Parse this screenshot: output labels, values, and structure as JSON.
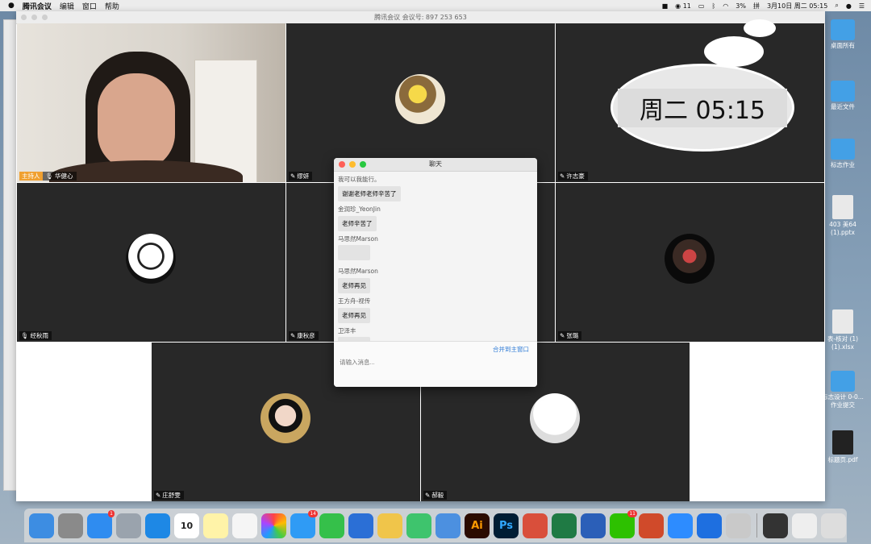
{
  "menubar": {
    "app": "腾讯会议",
    "items": [
      "编辑",
      "窗口",
      "帮助"
    ],
    "wechat_badge": "11",
    "battery": "3%",
    "datetime": "3月10日 周二  05:15"
  },
  "window": {
    "title": "腾讯会议 会议号: 897 253 653"
  },
  "participants": [
    {
      "name": "华健心",
      "host_label": "主持人"
    },
    {
      "name": "缪妍"
    },
    {
      "name": "许志豪"
    },
    {
      "name": "经秋雨"
    },
    {
      "name": "康秋彦"
    },
    {
      "name": "张璐"
    },
    {
      "name": "庄舒雯"
    },
    {
      "name": "郝毅"
    }
  ],
  "overlay_clock": {
    "text": "周二  05:15"
  },
  "chat": {
    "title": "聊天",
    "messages": [
      {
        "sender": "我可以我能行。",
        "text": "谢谢老师老师辛苦了"
      },
      {
        "sender": "金润珍_YeonJin",
        "text": "老师辛苦了"
      },
      {
        "sender": "马思然Marson",
        "text": ""
      },
      {
        "sender": "马思然Marson",
        "text": "老师再见"
      },
      {
        "sender": "王方舟-视传",
        "text": "老师再见"
      },
      {
        "sender": "卫泽丰",
        "text": ""
      }
    ],
    "merge_label": "合并到主窗口",
    "input_placeholder": "请输入消息..."
  },
  "desktop": [
    {
      "label": "桌面所有",
      "kind": "folder"
    },
    {
      "label": "最近文件",
      "kind": "folder"
    },
    {
      "label": "标志作业",
      "kind": "folder"
    },
    {
      "label": "403 美64 (1).pptx",
      "kind": "doc"
    },
    {
      "label": "表-核对 (1)(1).xlsx",
      "kind": "doc"
    },
    {
      "label": "标志设计 0-0...作业提交",
      "kind": "folder"
    },
    {
      "label": "标题页.pdf",
      "kind": "doc"
    }
  ],
  "dock": {
    "badges": {
      "appstore": "1",
      "messages": "14",
      "wechat": "11"
    },
    "calendar_day": "10",
    "ai_label": "Ai",
    "ps_label": "Ps"
  }
}
